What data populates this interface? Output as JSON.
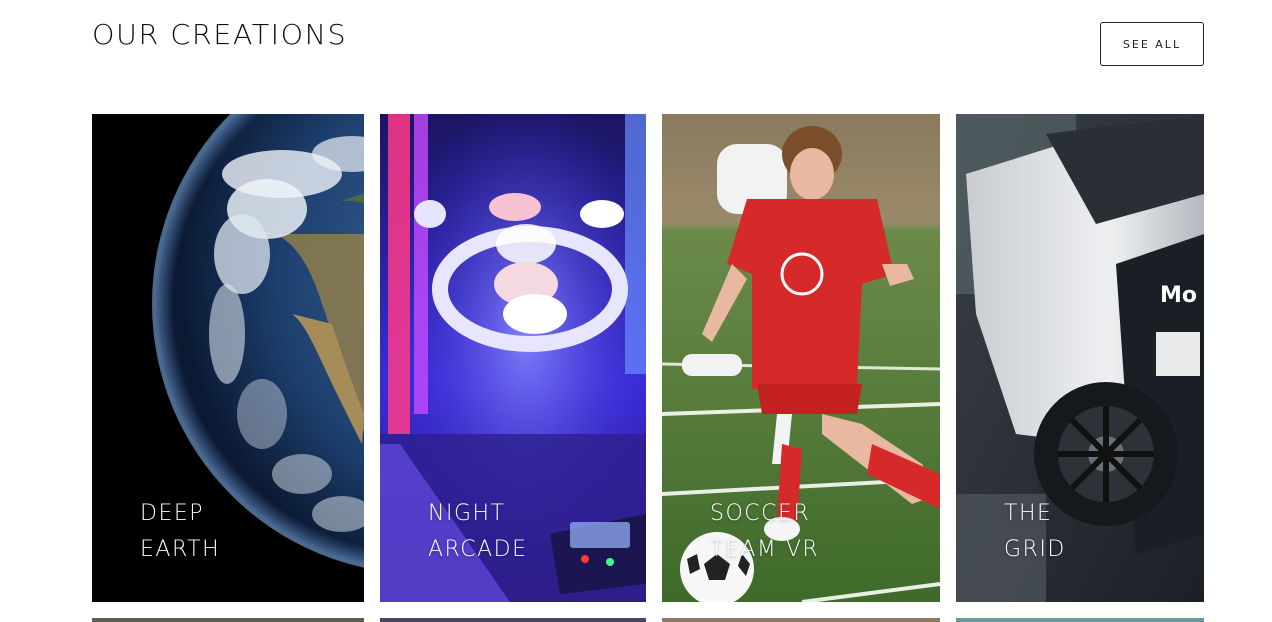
{
  "section": {
    "title": "OUR CREATIONS",
    "see_all_label": "SEE ALL"
  },
  "cards": [
    {
      "line1": "DEEP",
      "line2": "EARTH",
      "image": "earth-from-space"
    },
    {
      "line1": "NIGHT",
      "line2": "ARCADE",
      "image": "skee-ball-arcade"
    },
    {
      "line1": "SOCCER",
      "line2": "TEAM VR",
      "image": "soccer-player"
    },
    {
      "line1": "THE",
      "line2": "GRID",
      "image": "race-car"
    }
  ],
  "colors": {
    "text": "#111111",
    "card_label": "#ffffff",
    "soccer_jersey": "#d62a2a",
    "arcade_glow": "#5a3cff"
  }
}
